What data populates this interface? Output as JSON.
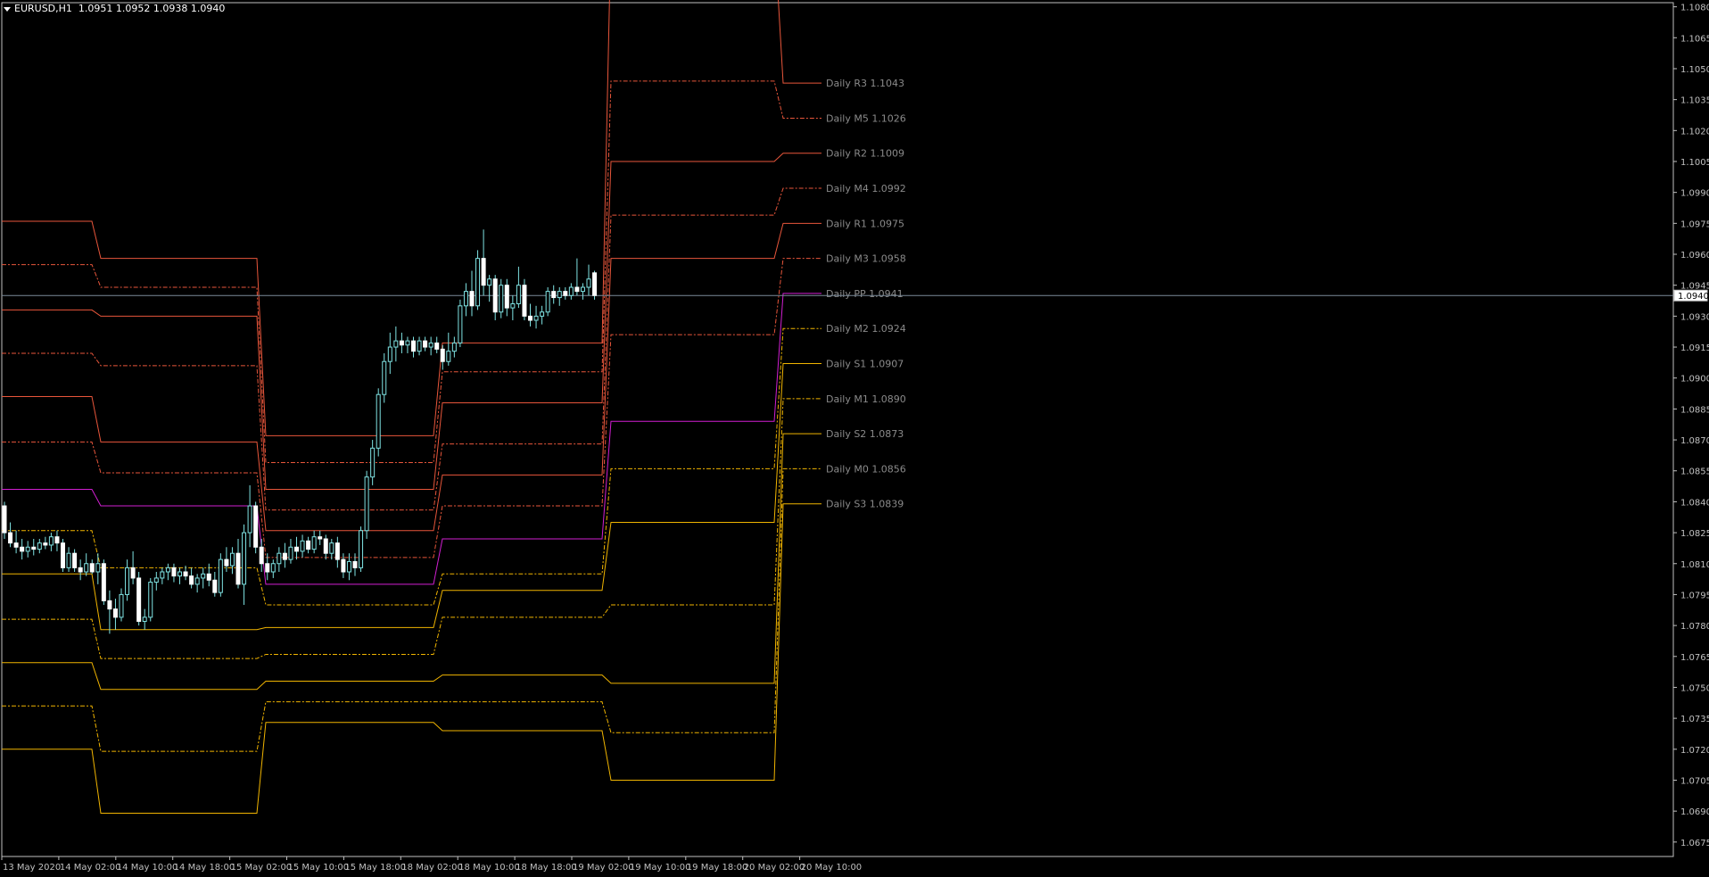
{
  "header": {
    "symbol": "EURUSD,H1",
    "ohlc": "1.0951 1.0952 1.0938 1.0940"
  },
  "price_marker": {
    "value": "1.0940"
  },
  "colors": {
    "background": "#000000",
    "axis": "#c0c0c0",
    "resistance": "#e8563b",
    "pivot": "#d11fd1",
    "support": "#f0b400",
    "label": "#8a8a8a",
    "candle": "#7fe3e3",
    "price_line": "#7a8a99"
  },
  "chart_data": {
    "type": "line",
    "title": "EURUSD,H1",
    "y_axis": {
      "ylim": [
        1.0668,
        1.1082
      ],
      "ticks": [
        "1.1080",
        "1.1065",
        "1.1050",
        "1.1035",
        "1.1020",
        "1.1005",
        "1.0990",
        "1.0975",
        "1.0960",
        "1.0945",
        "1.0930",
        "1.0915",
        "1.0900",
        "1.0885",
        "1.0870",
        "1.0855",
        "1.0840",
        "1.0825",
        "1.0810",
        "1.0795",
        "1.0780",
        "1.0765",
        "1.0750",
        "1.0735",
        "1.0720",
        "1.0705",
        "1.0690",
        "1.0675"
      ]
    },
    "x_axis": {
      "ticks": [
        "13 May 2020",
        "14 May 02:00",
        "14 May 10:00",
        "14 May 18:00",
        "15 May 02:00",
        "15 May 10:00",
        "15 May 18:00",
        "18 May 02:00",
        "18 May 10:00",
        "18 May 18:00",
        "19 May 02:00",
        "19 May 10:00",
        "19 May 18:00",
        "20 May 02:00",
        "20 May 10:00"
      ]
    },
    "pivot_labels": [
      {
        "text": "Daily R3 1.1043",
        "value": 1.1043,
        "kind": "R"
      },
      {
        "text": "Daily M5 1.1026",
        "value": 1.1026,
        "kind": "R"
      },
      {
        "text": "Daily R2 1.1009",
        "value": 1.1009,
        "kind": "R"
      },
      {
        "text": "Daily M4 1.0992",
        "value": 1.0992,
        "kind": "R"
      },
      {
        "text": "Daily R1 1.0975",
        "value": 1.0975,
        "kind": "R"
      },
      {
        "text": "Daily M3 1.0958",
        "value": 1.0958,
        "kind": "R"
      },
      {
        "text": "Daily PP 1.0941",
        "value": 1.0941,
        "kind": "P"
      },
      {
        "text": "Daily M2 1.0924",
        "value": 1.0924,
        "kind": "S"
      },
      {
        "text": "Daily S1 1.0907",
        "value": 1.0907,
        "kind": "S"
      },
      {
        "text": "Daily M1 1.0890",
        "value": 1.089,
        "kind": "S"
      },
      {
        "text": "Daily S2 1.0873",
        "value": 1.0873,
        "kind": "S"
      },
      {
        "text": "Daily M0 1.0856",
        "value": 1.0856,
        "kind": "S"
      },
      {
        "text": "Daily S3 1.0839",
        "value": 1.0839,
        "kind": "S"
      }
    ],
    "day_levels": [
      {
        "day": "13 May (partial)",
        "R3": 1.0976,
        "M5": 1.0955,
        "R2": 1.0933,
        "M4": 1.0912,
        "R1": 1.0891,
        "M3": 1.0869,
        "PP": 1.0846,
        "M2": 1.0826,
        "S1": 1.0805,
        "M1": 1.0783,
        "S2": 1.0762,
        "M0": 1.0741,
        "S3": 1.072
      },
      {
        "day": "14 May",
        "R3": 1.0958,
        "M5": 1.0944,
        "R2": 1.093,
        "M4": 1.0906,
        "R1": 1.0869,
        "M3": 1.0854,
        "PP": 1.0838,
        "M2": 1.0808,
        "S1": 1.0778,
        "M1": 1.0764,
        "S2": 1.0749,
        "M0": 1.0719,
        "S3": 1.0689
      },
      {
        "day": "15 May",
        "R3": 1.0872,
        "M5": 1.0859,
        "R2": 1.0846,
        "M4": 1.0836,
        "R1": 1.0826,
        "M3": 1.0813,
        "PP": 1.08,
        "M2": 1.079,
        "S1": 1.0779,
        "M1": 1.0766,
        "S2": 1.0753,
        "M0": 1.0743,
        "S3": 1.0733
      },
      {
        "day": "18 May",
        "R3": 1.0917,
        "M5": 1.0903,
        "R2": 1.0888,
        "M4": 1.0868,
        "R1": 1.0853,
        "M3": 1.0838,
        "PP": 1.0822,
        "M2": 1.0805,
        "S1": 1.0797,
        "M1": 1.0784,
        "S2": 1.0756,
        "M0": 1.0743,
        "S3": 1.0729
      },
      {
        "day": "19 May",
        "R3": 1.1117,
        "M5": 1.1044,
        "R2": 1.1005,
        "M4": 1.0979,
        "R1": 1.0958,
        "M3": 1.0921,
        "PP": 1.0879,
        "M2": 1.0856,
        "S1": 1.083,
        "M1": 1.079,
        "S2": 1.0752,
        "M0": 1.0728,
        "S3": 1.0705
      },
      {
        "day": "20 May",
        "R3": 1.1043,
        "M5": 1.1026,
        "R2": 1.1009,
        "M4": 1.0992,
        "R1": 1.0975,
        "M3": 1.0958,
        "PP": 1.0941,
        "M2": 1.0924,
        "S1": 1.0907,
        "M1": 1.089,
        "S2": 1.0873,
        "M0": 1.0856,
        "S3": 1.0839
      }
    ],
    "candles": [
      [
        1.0838,
        1.084,
        1.0822,
        1.0825
      ],
      [
        1.0825,
        1.083,
        1.0818,
        1.082
      ],
      [
        1.082,
        1.0826,
        1.0815,
        1.0818
      ],
      [
        1.0818,
        1.0822,
        1.0812,
        1.0816
      ],
      [
        1.0816,
        1.0821,
        1.0813,
        1.0818
      ],
      [
        1.0818,
        1.0822,
        1.0814,
        1.0817
      ],
      [
        1.0817,
        1.0822,
        1.0815,
        1.082
      ],
      [
        1.082,
        1.0823,
        1.0817,
        1.0819
      ],
      [
        1.0819,
        1.0825,
        1.0816,
        1.0823
      ],
      [
        1.0823,
        1.0826,
        1.0816,
        1.082
      ],
      [
        1.082,
        1.0822,
        1.0806,
        1.0808
      ],
      [
        1.0808,
        1.0818,
        1.0806,
        1.0815
      ],
      [
        1.0815,
        1.0817,
        1.0806,
        1.0808
      ],
      [
        1.0808,
        1.0812,
        1.0802,
        1.0806
      ],
      [
        1.0806,
        1.0815,
        1.0804,
        1.081
      ],
      [
        1.081,
        1.0812,
        1.0805,
        1.0806
      ],
      [
        1.0806,
        1.0815,
        1.08,
        1.081
      ],
      [
        1.081,
        1.0812,
        1.079,
        1.0792
      ],
      [
        1.0792,
        1.0797,
        1.0776,
        1.0788
      ],
      [
        1.0788,
        1.0793,
        1.0778,
        1.0784
      ],
      [
        1.0784,
        1.0798,
        1.0782,
        1.0795
      ],
      [
        1.0795,
        1.0812,
        1.0792,
        1.0808
      ],
      [
        1.0808,
        1.0816,
        1.08,
        1.0803
      ],
      [
        1.0803,
        1.0806,
        1.078,
        1.0782
      ],
      [
        1.0782,
        1.0788,
        1.0778,
        1.0784
      ],
      [
        1.0784,
        1.0803,
        1.0782,
        1.0801
      ],
      [
        1.0801,
        1.0806,
        1.0797,
        1.0803
      ],
      [
        1.0803,
        1.0808,
        1.08,
        1.0806
      ],
      [
        1.0806,
        1.081,
        1.0802,
        1.0808
      ],
      [
        1.0808,
        1.081,
        1.0801,
        1.0804
      ],
      [
        1.0804,
        1.0808,
        1.08,
        1.0806
      ],
      [
        1.0806,
        1.0809,
        1.0802,
        1.0804
      ],
      [
        1.0804,
        1.0808,
        1.0798,
        1.08
      ],
      [
        1.08,
        1.0805,
        1.0796,
        1.0803
      ],
      [
        1.0803,
        1.0808,
        1.0798,
        1.0805
      ],
      [
        1.0805,
        1.081,
        1.0799,
        1.0802
      ],
      [
        1.0802,
        1.0806,
        1.0794,
        1.0796
      ],
      [
        1.0796,
        1.0815,
        1.0794,
        1.0812
      ],
      [
        1.0812,
        1.0818,
        1.0806,
        1.0809
      ],
      [
        1.0809,
        1.0818,
        1.0805,
        1.0815
      ],
      [
        1.0815,
        1.0822,
        1.0798,
        1.08
      ],
      [
        1.08,
        1.0829,
        1.079,
        1.0825
      ],
      [
        1.0825,
        1.0848,
        1.0818,
        1.0838
      ],
      [
        1.0838,
        1.084,
        1.0815,
        1.0818
      ],
      [
        1.0818,
        1.0822,
        1.0806,
        1.081
      ],
      [
        1.081,
        1.0815,
        1.0802,
        1.0806
      ],
      [
        1.0806,
        1.0812,
        1.0803,
        1.081
      ],
      [
        1.081,
        1.0818,
        1.0806,
        1.0815
      ],
      [
        1.0815,
        1.082,
        1.0808,
        1.0812
      ],
      [
        1.0812,
        1.0822,
        1.081,
        1.0818
      ],
      [
        1.0818,
        1.0823,
        1.0812,
        1.0816
      ],
      [
        1.0816,
        1.0824,
        1.0813,
        1.0821
      ],
      [
        1.0821,
        1.0823,
        1.0815,
        1.0817
      ],
      [
        1.0817,
        1.0826,
        1.0815,
        1.0823
      ],
      [
        1.0823,
        1.0826,
        1.0819,
        1.0822
      ],
      [
        1.0822,
        1.0824,
        1.0812,
        1.0815
      ],
      [
        1.0815,
        1.0822,
        1.0812,
        1.082
      ],
      [
        1.082,
        1.0823,
        1.0808,
        1.0812
      ],
      [
        1.0812,
        1.0815,
        1.0803,
        1.0806
      ],
      [
        1.0806,
        1.0815,
        1.0802,
        1.0811
      ],
      [
        1.0811,
        1.0815,
        1.0804,
        1.0808
      ],
      [
        1.0808,
        1.0828,
        1.0806,
        1.0826
      ],
      [
        1.0826,
        1.0855,
        1.0822,
        1.0852
      ],
      [
        1.0852,
        1.087,
        1.0848,
        1.0866
      ],
      [
        1.0866,
        1.0895,
        1.0862,
        1.0892
      ],
      [
        1.0892,
        1.0912,
        1.0888,
        1.0908
      ],
      [
        1.0908,
        1.0922,
        1.0902,
        1.0915
      ],
      [
        1.0915,
        1.0925,
        1.0908,
        1.0918
      ],
      [
        1.0918,
        1.0922,
        1.0912,
        1.0916
      ],
      [
        1.0916,
        1.092,
        1.0912,
        1.0918
      ],
      [
        1.0918,
        1.092,
        1.091,
        1.0913
      ],
      [
        1.0913,
        1.092,
        1.0911,
        1.0918
      ],
      [
        1.0918,
        1.092,
        1.0913,
        1.0915
      ],
      [
        1.0915,
        1.092,
        1.0911,
        1.0917
      ],
      [
        1.0917,
        1.092,
        1.0912,
        1.0914
      ],
      [
        1.0914,
        1.0916,
        1.0904,
        1.0908
      ],
      [
        1.0908,
        1.0922,
        1.0906,
        1.0913
      ],
      [
        1.0913,
        1.092,
        1.091,
        1.0917
      ],
      [
        1.0917,
        1.0938,
        1.0915,
        1.0935
      ],
      [
        1.0935,
        1.0946,
        1.093,
        1.0942
      ],
      [
        1.0942,
        1.0952,
        1.093,
        1.0935
      ],
      [
        1.0935,
        1.0962,
        1.0933,
        1.0958
      ],
      [
        1.0958,
        1.0972,
        1.094,
        1.0945
      ],
      [
        1.0945,
        1.095,
        1.0937,
        1.0948
      ],
      [
        1.0948,
        1.095,
        1.0928,
        1.0932
      ],
      [
        1.0932,
        1.0948,
        1.0929,
        1.0945
      ],
      [
        1.0945,
        1.0948,
        1.093,
        1.0934
      ],
      [
        1.0934,
        1.094,
        1.0928,
        1.0936
      ],
      [
        1.0936,
        1.0954,
        1.0934,
        1.0945
      ],
      [
        1.0945,
        1.0948,
        1.0928,
        1.093
      ],
      [
        1.093,
        1.0936,
        1.0925,
        1.0928
      ],
      [
        1.0928,
        1.0935,
        1.0924,
        1.093
      ],
      [
        1.093,
        1.0935,
        1.0926,
        1.0932
      ],
      [
        1.0932,
        1.0944,
        1.093,
        1.0942
      ],
      [
        1.0942,
        1.0945,
        1.0936,
        1.0939
      ],
      [
        1.0939,
        1.0944,
        1.0935,
        1.0942
      ],
      [
        1.0942,
        1.0944,
        1.0938,
        1.094
      ],
      [
        1.094,
        1.0946,
        1.0938,
        1.0944
      ],
      [
        1.0944,
        1.0958,
        1.094,
        1.0942
      ],
      [
        1.0942,
        1.0946,
        1.0938,
        1.0944
      ],
      [
        1.0944,
        1.0955,
        1.094,
        1.0948
      ],
      [
        1.0951,
        1.0952,
        1.0938,
        1.094
      ]
    ]
  }
}
